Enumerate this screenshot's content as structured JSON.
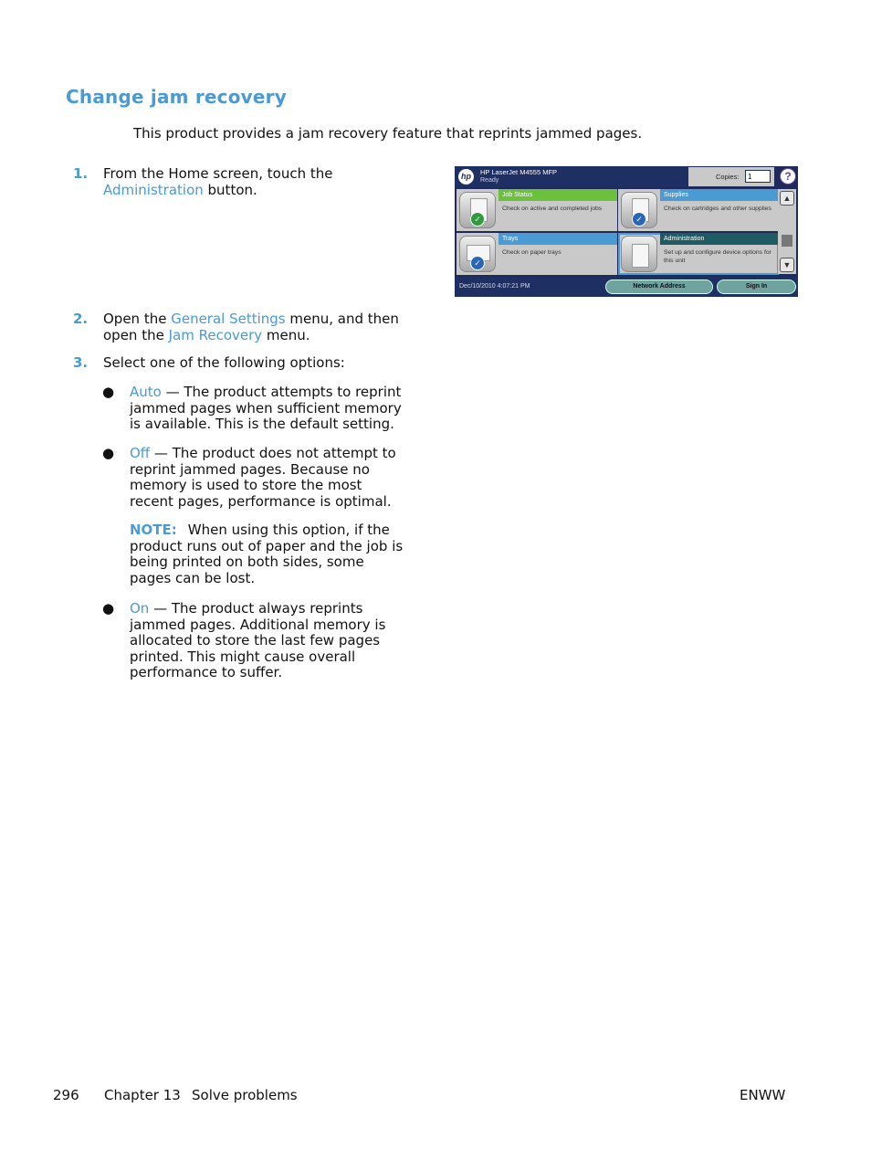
{
  "heading": "Change jam recovery",
  "intro": "This product provides a jam recovery feature that reprints jammed pages.",
  "steps": [
    {
      "num": "1.",
      "pre": "From the Home screen, touch the ",
      "link": "Administration",
      "post": " button."
    },
    {
      "num": "2.",
      "pre": "Open the ",
      "link": "General Settings",
      "mid": " menu, and then open the ",
      "link2": "Jam Recovery",
      "post": " menu."
    },
    {
      "num": "3.",
      "text": "Select one of the following options:"
    }
  ],
  "options": [
    {
      "bullet": "●",
      "name": "Auto",
      "text": " — The product attempts to reprint jammed pages when sufficient memory is available. This is the default setting."
    },
    {
      "bullet": "●",
      "name": "Off",
      "text": " — The product does not attempt to reprint jammed pages. Because no memory is used to store the most recent pages, performance is optimal."
    },
    {
      "bullet": "●",
      "name": "On",
      "text": " — The product always reprints jammed pages. Additional memory is allocated to store the last few pages printed. This might cause overall performance to suffer."
    }
  ],
  "note": {
    "label": "NOTE:",
    "text": "When using this option, if the product runs out of paper and the job is being printed on both sides, some pages can be lost."
  },
  "panel": {
    "logo": "hp",
    "title": "HP LaserJet M4555 MFP",
    "status": "Ready",
    "copies_label": "Copies:",
    "copies_value": "1",
    "help": "?",
    "tiles": [
      {
        "title": "Job Status",
        "desc": "Check on active and completed jobs",
        "color": "#6cc13c"
      },
      {
        "title": "Supplies",
        "desc": "Check on cartridges and other supplies",
        "color": "#4a9ad4"
      },
      {
        "title": "Trays",
        "desc": "Check on paper trays",
        "color": "#4a9ad4"
      },
      {
        "title": "Administration",
        "desc": "Set up and configure device options for this unit",
        "color": "#1f5b62"
      }
    ],
    "check": "✓",
    "scroll_up": "▲",
    "scroll_down": "▼",
    "datetime": "Dec/10/2010 4:07:21 PM",
    "network_button": "Network Address",
    "signin_button": "Sign In"
  },
  "footer": {
    "page": "296",
    "chapter": "Chapter 13",
    "section": "Solve problems",
    "right": "ENWW"
  }
}
